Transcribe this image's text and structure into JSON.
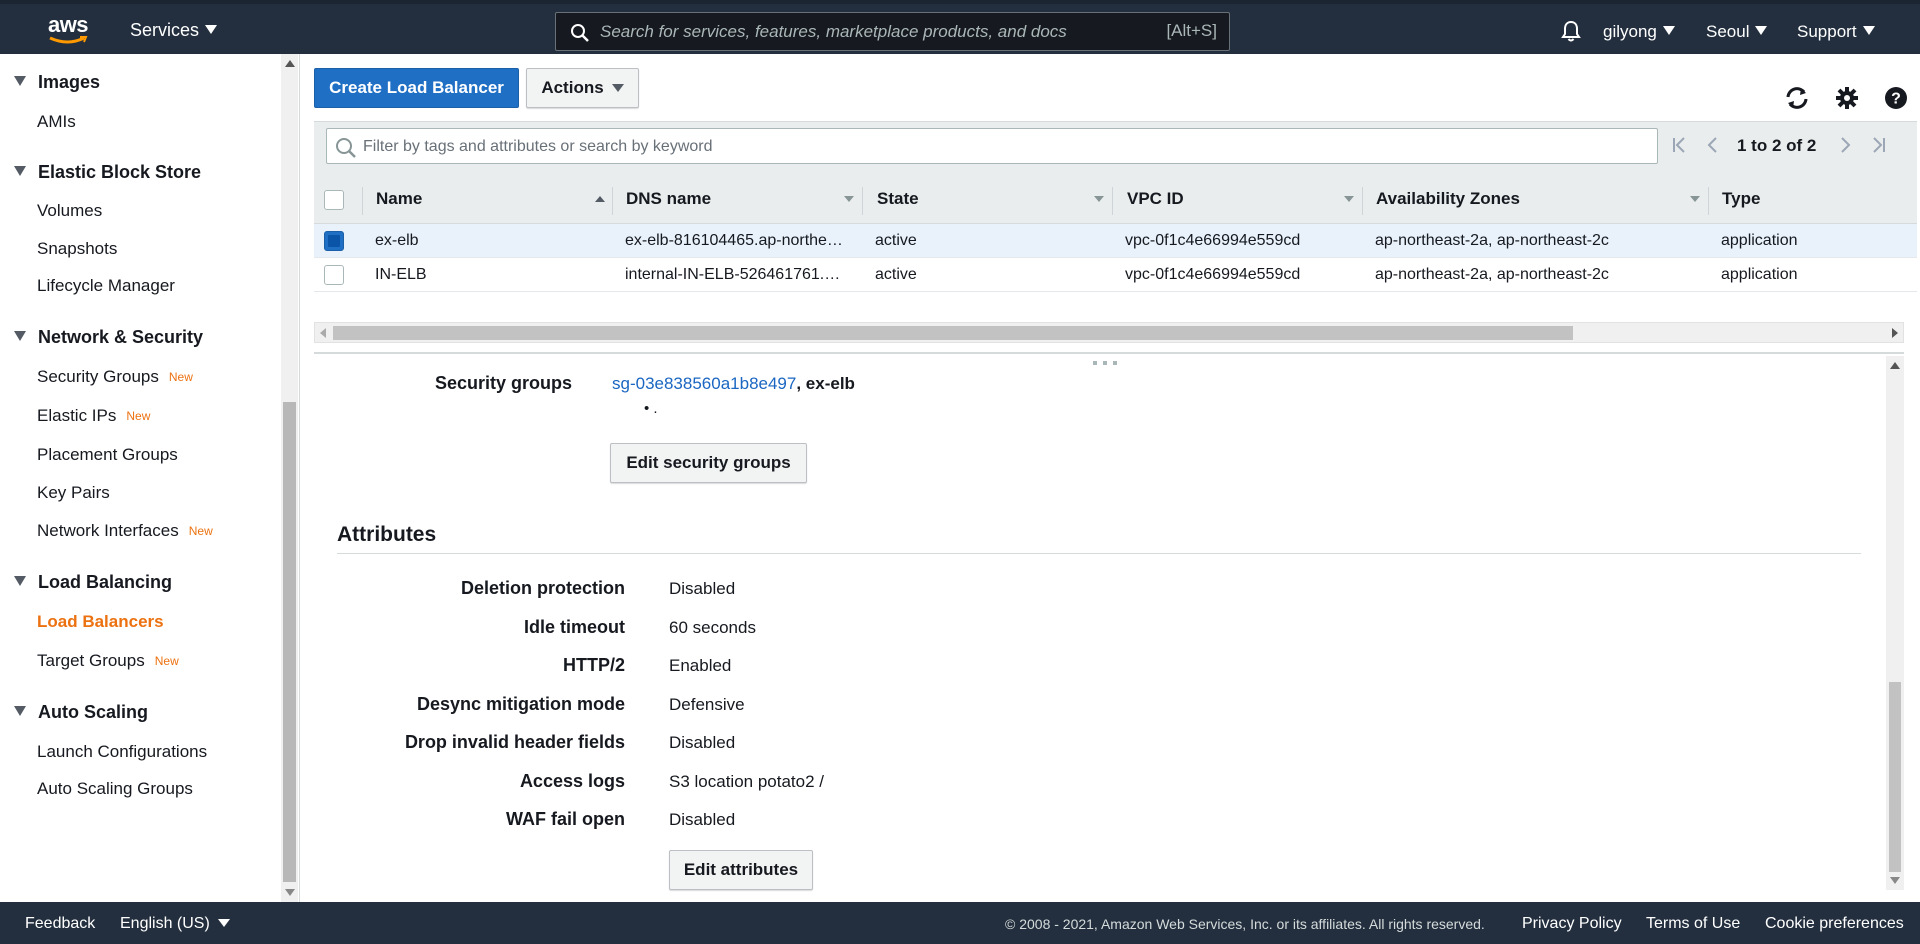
{
  "colors": {
    "nav_bg": "#232f3e",
    "primary": "#1f6fc5",
    "accent_orange": "#ec7211",
    "link": "#1a66c2"
  },
  "topnav": {
    "logo_text": "aws",
    "services_label": "Services",
    "search_placeholder": "Search for services, features, marketplace products, and docs",
    "search_shortcut": "[Alt+S]",
    "user": "gilyong",
    "region": "Seoul",
    "support": "Support"
  },
  "sidebar": {
    "sections": [
      {
        "title": "Images",
        "items": [
          {
            "label": "AMIs"
          }
        ]
      },
      {
        "title": "Elastic Block Store",
        "items": [
          {
            "label": "Volumes"
          },
          {
            "label": "Snapshots"
          },
          {
            "label": "Lifecycle Manager"
          }
        ]
      },
      {
        "title": "Network & Security",
        "items": [
          {
            "label": "Security Groups",
            "badge": "New"
          },
          {
            "label": "Elastic IPs",
            "badge": "New"
          },
          {
            "label": "Placement Groups"
          },
          {
            "label": "Key Pairs"
          },
          {
            "label": "Network Interfaces",
            "badge": "New"
          }
        ]
      },
      {
        "title": "Load Balancing",
        "items": [
          {
            "label": "Load Balancers",
            "active": true
          },
          {
            "label": "Target Groups",
            "badge": "New"
          }
        ]
      },
      {
        "title": "Auto Scaling",
        "items": [
          {
            "label": "Launch Configurations"
          },
          {
            "label": "Auto Scaling Groups"
          }
        ]
      }
    ]
  },
  "toolbar": {
    "create_label": "Create Load Balancer",
    "actions_label": "Actions",
    "refresh_icon": "refresh-icon",
    "settings_icon": "gear-icon",
    "help_icon": "help-icon"
  },
  "filter": {
    "placeholder": "Filter by tags and attributes or search by keyword",
    "pagination": "1 to 2 of 2"
  },
  "table": {
    "columns": [
      "Name",
      "DNS name",
      "State",
      "VPC ID",
      "Availability Zones",
      "Type"
    ],
    "rows": [
      {
        "selected": true,
        "name": "ex-elb",
        "dns": "ex-elb-816104465.ap-northe…",
        "state": "active",
        "vpc": "vpc-0f1c4e66994e559cd",
        "az": "ap-northeast-2a, ap-northeast-2c",
        "type": "application"
      },
      {
        "selected": false,
        "name": "IN-ELB",
        "dns": "internal-IN-ELB-526461761.…",
        "state": "active",
        "vpc": "vpc-0f1c4e66994e559cd",
        "az": "ap-northeast-2a, ap-northeast-2c",
        "type": "application"
      }
    ]
  },
  "details": {
    "security_groups_label": "Security groups",
    "security_group_link": "sg-03e838560a1b8e497",
    "security_group_name": ", ex-elb",
    "security_group_bullet": "• .",
    "edit_security_groups": "Edit security groups",
    "attributes_title": "Attributes",
    "attributes": [
      {
        "label": "Deletion protection",
        "value": "Disabled"
      },
      {
        "label": "Idle timeout",
        "value": "60 seconds"
      },
      {
        "label": "HTTP/2",
        "value": "Enabled"
      },
      {
        "label": "Desync mitigation mode",
        "value": "Defensive"
      },
      {
        "label": "Drop invalid header fields",
        "value": "Disabled"
      },
      {
        "label": "Access logs",
        "value": "S3 location potato2 /"
      },
      {
        "label": "WAF fail open",
        "value": "Disabled"
      }
    ],
    "edit_attributes": "Edit attributes"
  },
  "footer": {
    "feedback": "Feedback",
    "language": "English (US)",
    "copyright": "© 2008 - 2021, Amazon Web Services, Inc. or its affiliates. All rights reserved.",
    "privacy": "Privacy Policy",
    "terms": "Terms of Use",
    "cookies": "Cookie preferences"
  }
}
